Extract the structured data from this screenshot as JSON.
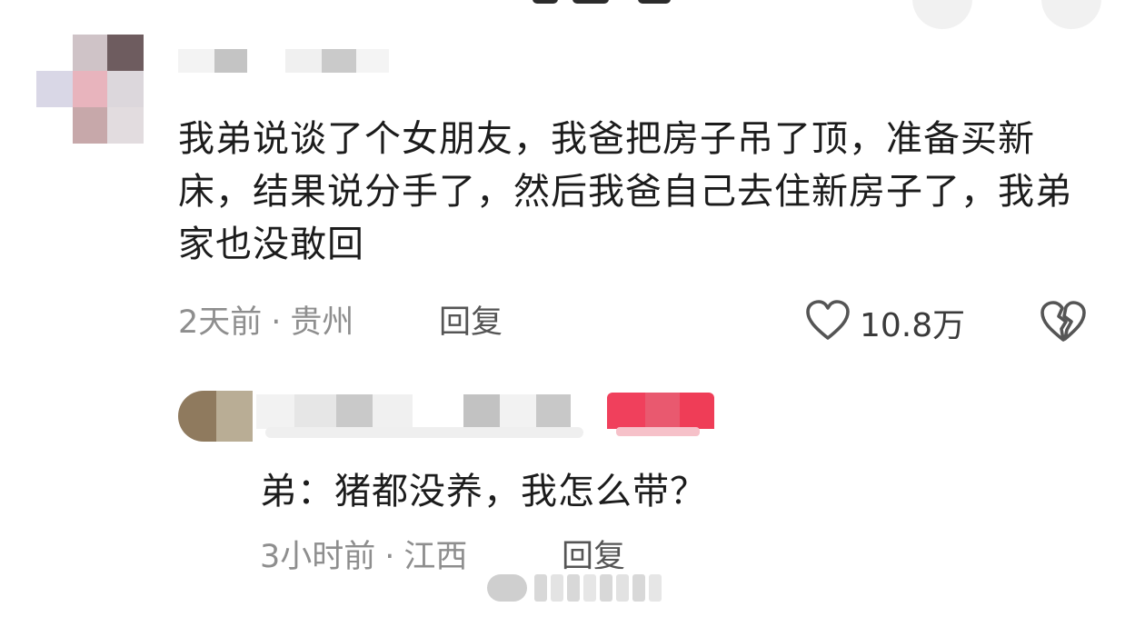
{
  "comment": {
    "username_masked": true,
    "text": "我弟说谈了个女朋友，我爸把房子吊了顶，准备买新床，结果说分手了，然后我爸自己去住新房子了，我弟家也没敢回",
    "time": "2天前",
    "location": "贵州",
    "separator": "·",
    "reply_label": "回复",
    "like_count": "10.8万",
    "like_icon": "heart-outline-icon",
    "dislike_icon": "broken-heart-icon"
  },
  "reply": {
    "username_masked": true,
    "text": "弟：猪都没养，我怎么带？",
    "time": "3小时前",
    "location": "江西",
    "separator": "·",
    "reply_label": "回复",
    "badge_color": "#f0405c"
  },
  "colors": {
    "text": "#1c1c1c",
    "meta": "#8e8e8e",
    "accent_badge": "#f0405c"
  }
}
